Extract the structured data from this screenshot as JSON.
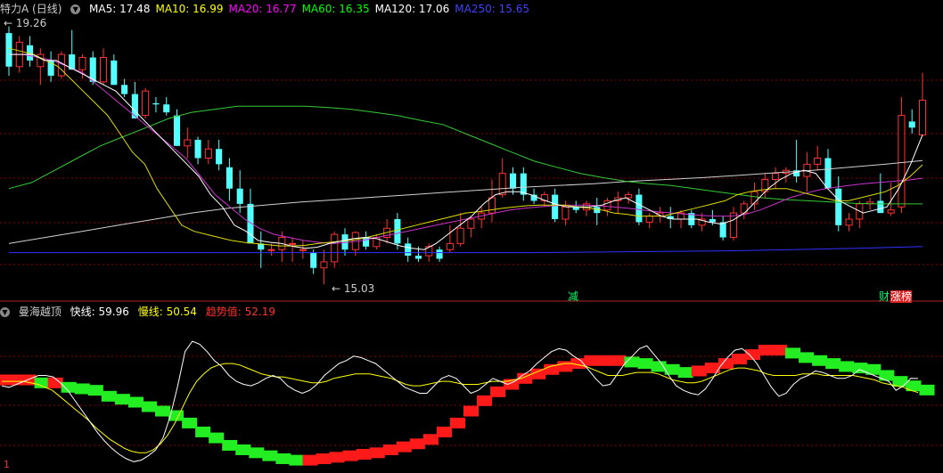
{
  "header": {
    "stock": "特力A (日线)",
    "ma": [
      {
        "label": "MA5: 17.48",
        "color": "#ffffff"
      },
      {
        "label": "MA10: 16.99",
        "color": "#ffff00"
      },
      {
        "label": "MA20: 16.77",
        "color": "#ff00ff"
      },
      {
        "label": "MA60: 16.35",
        "color": "#00ff00"
      },
      {
        "label": "MA120: 17.06",
        "color": "#ffffff"
      },
      {
        "label": "MA250: 15.65",
        "color": "#4040ff"
      }
    ]
  },
  "indicator": {
    "name": "曼海越顶",
    "fast_label": "快线: 59.96",
    "slow_label": "慢线: 50.54",
    "trend_label": "趋势值: 52.19"
  },
  "tags": {
    "jian": "减",
    "cai": "财",
    "zhang": "涨榜",
    "high_label": "19.26",
    "low_label": "15.03",
    "bottom_num": "1"
  },
  "colors": {
    "up": "#ff3232",
    "down": "#54ffff",
    "bg": "#000000",
    "grid": "#8b0000"
  },
  "chart_data": [
    {
      "type": "candlestick",
      "title": "特力A (日线)",
      "ylim": [
        14.8,
        19.4
      ],
      "candles": [
        [
          19.15,
          19.26,
          18.45,
          18.6
        ],
        [
          18.6,
          19.1,
          18.5,
          19.0
        ],
        [
          18.95,
          19.1,
          18.6,
          18.7
        ],
        [
          18.6,
          18.9,
          18.3,
          18.8
        ],
        [
          18.7,
          18.85,
          18.35,
          18.45
        ],
        [
          18.45,
          18.85,
          18.4,
          18.8
        ],
        [
          18.8,
          19.2,
          18.6,
          18.55
        ],
        [
          18.55,
          18.8,
          18.4,
          18.75
        ],
        [
          18.75,
          18.85,
          18.3,
          18.35
        ],
        [
          18.35,
          18.9,
          18.3,
          18.75
        ],
        [
          18.7,
          18.8,
          18.3,
          18.3
        ],
        [
          18.3,
          18.4,
          18.1,
          18.15
        ],
        [
          18.15,
          18.35,
          17.8,
          17.75
        ],
        [
          17.8,
          18.25,
          17.75,
          18.2
        ],
        [
          18.0,
          18.1,
          17.85,
          17.98
        ],
        [
          17.98,
          18.1,
          17.8,
          17.85
        ],
        [
          17.8,
          17.9,
          17.3,
          17.3
        ],
        [
          17.3,
          17.6,
          17.1,
          17.4
        ],
        [
          17.4,
          17.45,
          17.0,
          17.1
        ],
        [
          17.1,
          17.4,
          17.0,
          17.25
        ],
        [
          17.25,
          17.4,
          16.9,
          17.0
        ],
        [
          16.95,
          17.1,
          16.4,
          16.6
        ],
        [
          16.6,
          16.9,
          16.2,
          16.35
        ],
        [
          16.35,
          16.6,
          15.7,
          15.7
        ],
        [
          15.7,
          15.9,
          15.3,
          15.6
        ],
        [
          15.6,
          15.7,
          15.5,
          15.6
        ],
        [
          15.6,
          15.9,
          15.4,
          15.8
        ],
        [
          15.7,
          15.8,
          15.4,
          15.7
        ],
        [
          15.6,
          15.75,
          15.45,
          15.6
        ],
        [
          15.55,
          15.6,
          15.2,
          15.3
        ],
        [
          15.3,
          15.6,
          15.03,
          15.4
        ],
        [
          15.4,
          15.9,
          15.3,
          15.85
        ],
        [
          15.85,
          15.95,
          15.5,
          15.6
        ],
        [
          15.6,
          15.9,
          15.5,
          15.88
        ],
        [
          15.8,
          15.9,
          15.6,
          15.65
        ],
        [
          15.65,
          15.85,
          15.6,
          15.8
        ],
        [
          15.8,
          16.1,
          15.7,
          15.95
        ],
        [
          16.1,
          16.2,
          15.6,
          15.7
        ],
        [
          15.7,
          15.8,
          15.4,
          15.5
        ],
        [
          15.5,
          15.65,
          15.4,
          15.45
        ],
        [
          15.5,
          15.7,
          15.4,
          15.65
        ],
        [
          15.6,
          15.65,
          15.4,
          15.45
        ],
        [
          15.6,
          16.0,
          15.55,
          15.7
        ],
        [
          15.7,
          16.2,
          15.65,
          15.95
        ],
        [
          15.95,
          16.15,
          15.8,
          16.1
        ],
        [
          16.1,
          16.3,
          15.95,
          16.2
        ],
        [
          16.2,
          16.75,
          16.05,
          16.45
        ],
        [
          16.5,
          17.1,
          16.45,
          16.85
        ],
        [
          16.85,
          16.95,
          16.5,
          16.6
        ],
        [
          16.85,
          16.95,
          16.4,
          16.5
        ],
        [
          16.5,
          16.6,
          16.35,
          16.4
        ],
        [
          16.4,
          16.55,
          16.3,
          16.5
        ],
        [
          16.5,
          16.6,
          16.05,
          16.1
        ],
        [
          16.1,
          16.4,
          16.0,
          16.3
        ],
        [
          16.3,
          16.4,
          16.2,
          16.25
        ],
        [
          16.25,
          16.4,
          16.15,
          16.35
        ],
        [
          16.3,
          16.45,
          16.0,
          16.2
        ],
        [
          16.25,
          16.45,
          16.15,
          16.4
        ],
        [
          16.4,
          16.55,
          16.2,
          16.45
        ],
        [
          16.45,
          16.55,
          16.35,
          16.5
        ],
        [
          16.5,
          16.6,
          16.0,
          16.05
        ],
        [
          16.05,
          16.2,
          15.95,
          16.15
        ],
        [
          16.15,
          16.3,
          16.05,
          16.2
        ],
        [
          16.15,
          16.3,
          15.95,
          16.1
        ],
        [
          16.1,
          16.25,
          15.95,
          16.2
        ],
        [
          16.2,
          16.25,
          15.95,
          16.0
        ],
        [
          16.0,
          16.2,
          15.9,
          16.1
        ],
        [
          16.1,
          16.25,
          16.0,
          16.05
        ],
        [
          16.05,
          16.15,
          15.75,
          15.8
        ],
        [
          15.8,
          16.3,
          15.75,
          16.2
        ],
        [
          16.2,
          16.4,
          16.1,
          16.35
        ],
        [
          16.35,
          16.7,
          16.25,
          16.55
        ],
        [
          16.55,
          16.85,
          16.45,
          16.75
        ],
        [
          16.75,
          16.95,
          16.6,
          16.85
        ],
        [
          16.85,
          16.95,
          16.7,
          16.9
        ],
        [
          16.9,
          17.4,
          16.7,
          16.8
        ],
        [
          16.8,
          17.2,
          16.55,
          17.0
        ],
        [
          17.0,
          17.3,
          16.9,
          17.1
        ],
        [
          17.1,
          17.25,
          16.9,
          16.6
        ],
        [
          16.6,
          16.8,
          15.9,
          16.0
        ],
        [
          16.0,
          16.2,
          15.9,
          16.1
        ],
        [
          16.1,
          16.4,
          15.95,
          16.35
        ],
        [
          16.35,
          16.45,
          16.25,
          16.38
        ],
        [
          16.4,
          16.85,
          16.3,
          16.2
        ],
        [
          16.2,
          16.7,
          16.15,
          16.25
        ],
        [
          16.3,
          18.1,
          16.2,
          17.8
        ],
        [
          17.7,
          17.9,
          17.5,
          17.6
        ],
        [
          17.48,
          18.5,
          17.48,
          18.05
        ]
      ],
      "ma5": [
        18.8,
        18.8,
        18.8,
        18.7,
        18.7,
        18.6,
        18.5,
        18.4,
        18.3,
        18.2,
        18.0,
        17.8,
        17.6,
        17.4,
        17.2,
        17.0,
        16.8,
        16.5,
        16.3,
        16.0,
        15.9,
        15.75,
        15.72,
        15.7,
        15.65,
        15.62,
        15.64,
        15.7,
        15.74,
        15.78,
        15.8,
        15.78,
        15.72,
        15.66,
        15.62,
        15.6,
        15.7,
        15.85,
        16.0,
        16.15,
        16.35,
        16.5,
        16.55,
        16.55,
        16.5,
        16.42,
        16.35,
        16.3,
        16.3,
        16.3,
        16.33,
        16.4,
        16.45,
        16.35,
        16.25,
        16.15,
        16.1,
        16.1,
        16.1,
        16.05,
        16.02,
        16.08,
        16.2,
        16.4,
        16.6,
        16.75,
        16.85,
        16.9,
        16.85,
        16.6,
        16.4,
        16.3,
        16.2,
        16.25,
        16.3,
        16.6,
        17.0,
        17.48
      ],
      "ma10": [
        18.9,
        18.85,
        18.8,
        18.7,
        18.6,
        18.4,
        18.2,
        18.0,
        17.8,
        17.5,
        17.2,
        17.0,
        16.6,
        16.3,
        16.0,
        15.9,
        15.85,
        15.8,
        15.75,
        15.72,
        15.7,
        15.68,
        15.66,
        15.66,
        15.67,
        15.7,
        15.72,
        15.74,
        15.76,
        15.8,
        15.85,
        15.9,
        15.95,
        16.0,
        16.05,
        16.1,
        16.15,
        16.2,
        16.22,
        16.25,
        16.28,
        16.3,
        16.32,
        16.33,
        16.33,
        16.33,
        16.3,
        16.28,
        16.25,
        16.2,
        16.18,
        16.15,
        16.15,
        16.15,
        16.2,
        16.25,
        16.3,
        16.35,
        16.4,
        16.5,
        16.55,
        16.58,
        16.6,
        16.6,
        16.55,
        16.5,
        16.45,
        16.4,
        16.4,
        16.45,
        16.5,
        16.55,
        16.65,
        16.8,
        16.99
      ],
      "ma20": [
        18.8,
        18.8,
        18.75,
        18.7,
        18.6,
        18.5,
        18.3,
        18.1,
        17.9,
        17.7,
        17.5,
        17.3,
        17.1,
        16.8,
        16.5,
        16.3,
        16.1,
        15.95,
        15.85,
        15.8,
        15.75,
        15.72,
        15.7,
        15.72,
        15.75,
        15.8,
        15.85,
        15.9,
        15.95,
        16.0,
        16.05,
        16.1,
        16.15,
        16.2,
        16.25,
        16.28,
        16.3,
        16.32,
        16.33,
        16.33,
        16.32,
        16.3,
        16.28,
        16.25,
        16.22,
        16.2,
        16.18,
        16.16,
        16.15,
        16.15,
        16.18,
        16.25,
        16.35,
        16.45,
        16.52,
        16.58,
        16.62,
        16.65,
        16.68,
        16.7,
        16.72,
        16.74,
        16.77
      ],
      "ma60": [
        16.6,
        16.7,
        16.9,
        17.1,
        17.3,
        17.45,
        17.6,
        17.75,
        17.85,
        17.9,
        17.95,
        17.95,
        17.95,
        17.95,
        17.93,
        17.9,
        17.85,
        17.8,
        17.72,
        17.65,
        17.5,
        17.35,
        17.2,
        17.05,
        16.95,
        16.85,
        16.78,
        16.72,
        16.68,
        16.65,
        16.6,
        16.55,
        16.5,
        16.45,
        16.42,
        16.4,
        16.38,
        16.36,
        16.35,
        16.35,
        16.35
      ],
      "ma120": [
        15.7,
        15.8,
        15.9,
        16.0,
        16.1,
        16.2,
        16.28,
        16.33,
        16.38,
        16.42,
        16.46,
        16.5,
        16.54,
        16.58,
        16.62,
        16.65,
        16.68,
        16.72,
        16.75,
        16.78,
        16.82,
        16.86,
        16.9,
        16.95,
        17.0,
        17.06
      ],
      "ma250": [
        15.55,
        15.55,
        15.55,
        15.55,
        15.55,
        15.55,
        15.55,
        15.55,
        15.55,
        15.56,
        15.57,
        15.58,
        15.6,
        15.62,
        15.65
      ]
    },
    {
      "type": "line",
      "title": "曼海越顶",
      "ylim": [
        0,
        100
      ],
      "series": [
        {
          "name": "快线",
          "values": [
            55,
            54,
            56,
            58,
            60,
            62,
            62,
            61,
            57,
            52,
            45,
            38,
            31,
            24,
            18,
            13,
            9,
            6,
            4,
            5,
            8,
            12,
            20,
            35,
            55,
            78,
            85,
            83,
            78,
            72,
            68,
            62,
            58,
            56,
            55,
            57,
            60,
            62,
            60,
            55,
            52,
            50,
            52,
            56,
            62,
            66,
            70,
            72,
            75,
            74,
            72,
            70,
            66,
            62,
            58,
            54,
            52,
            50,
            50,
            55,
            60,
            62,
            60,
            55,
            50,
            52,
            56,
            60,
            58,
            56,
            58,
            62,
            65,
            70,
            74,
            78,
            80,
            79,
            75,
            72,
            66,
            60,
            55,
            56,
            63,
            70,
            75,
            80,
            82,
            76,
            70,
            62,
            55,
            52,
            50,
            49,
            53,
            60,
            68,
            74,
            79,
            80,
            76,
            70,
            62,
            54,
            48,
            50,
            56,
            60,
            62,
            65,
            64,
            62,
            60,
            60,
            62,
            66,
            64,
            62,
            60,
            58,
            52,
            55,
            60,
            59.96
          ],
          "color": "#ffffff"
        },
        {
          "name": "慢线",
          "values": [
            58,
            58,
            58,
            58,
            57,
            56,
            54,
            52,
            48,
            44,
            40,
            36,
            32,
            27,
            23,
            19,
            16,
            13,
            11,
            10,
            10,
            12,
            16,
            22,
            30,
            40,
            50,
            58,
            63,
            67,
            69,
            70,
            70,
            69,
            67,
            65,
            63,
            62,
            61,
            61,
            60,
            59,
            58,
            57,
            57,
            58,
            60,
            61,
            62,
            63,
            63,
            63,
            62,
            61,
            60,
            58,
            56,
            55,
            55,
            56,
            57,
            58,
            58,
            57,
            56,
            56,
            56,
            57,
            58,
            58,
            58,
            59,
            60,
            62,
            64,
            66,
            68,
            69,
            70,
            70,
            69,
            68,
            66,
            64,
            62,
            62,
            62,
            63,
            64,
            64,
            64,
            63,
            61,
            59,
            58,
            57,
            57,
            58,
            60,
            62,
            64,
            66,
            67,
            67,
            66,
            65,
            63,
            62,
            62,
            62,
            62,
            63,
            63,
            63,
            62,
            62,
            62,
            62,
            62,
            61,
            60,
            59,
            57,
            56,
            55,
            54,
            52,
            50.54
          ],
          "color": "#ffff00"
        },
        {
          "name": "趋势值",
          "values": [
            59,
            59,
            59,
            57,
            57,
            54,
            53,
            52,
            48,
            46,
            44,
            41,
            38,
            35,
            30,
            24,
            20,
            15,
            12,
            10,
            8,
            6,
            5,
            5,
            6,
            7,
            8,
            9,
            10,
            12,
            14,
            16,
            19,
            24,
            30,
            38,
            45,
            51,
            56,
            60,
            63,
            66,
            68,
            70,
            72,
            72,
            72,
            71,
            70,
            68,
            66,
            64,
            65,
            67,
            70,
            73,
            76,
            79,
            79,
            77,
            74,
            72,
            70,
            68,
            67,
            66,
            62,
            58,
            55,
            52.19
          ],
          "color": "#ff0000"
        }
      ]
    }
  ]
}
